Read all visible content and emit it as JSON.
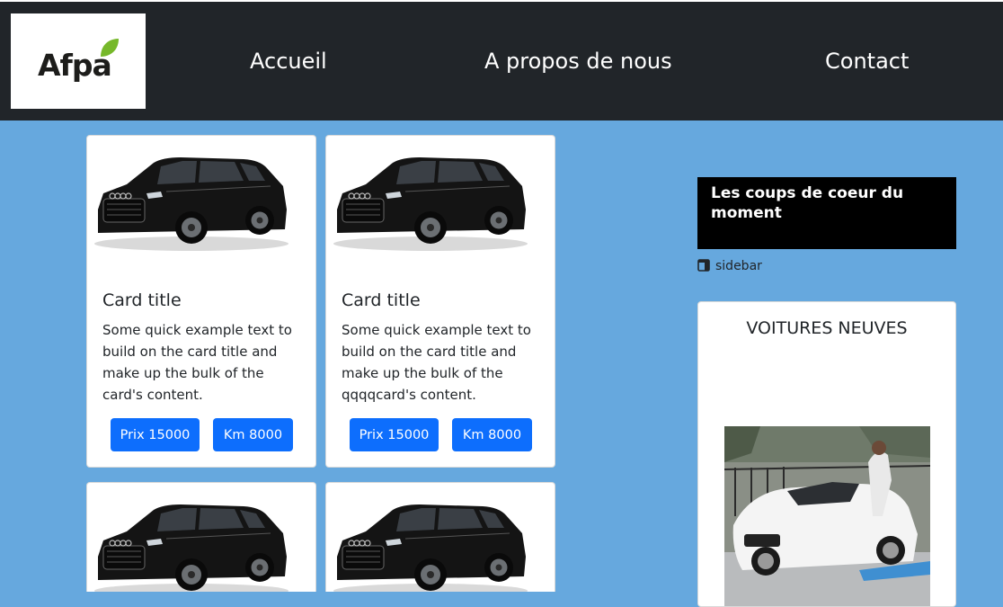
{
  "header": {
    "logo_text": "Afpa",
    "nav": [
      {
        "label": "Accueil"
      },
      {
        "label": "A propos de nous"
      },
      {
        "label": "Contact"
      }
    ]
  },
  "cards": [
    {
      "title": "Card title",
      "text": "Some quick example text to build on the card title and make up the bulk of the card's content.",
      "price_label": "Prix 15000",
      "km_label": "Km 8000"
    },
    {
      "title": "Card title",
      "text": "Some quick example text to build on the card title and make up the bulk of the qqqqcard's content.",
      "price_label": "Prix 15000",
      "km_label": "Km 8000"
    },
    {
      "title": "",
      "text": "",
      "price_label": "",
      "km_label": ""
    },
    {
      "title": "",
      "text": "",
      "price_label": "",
      "km_label": ""
    }
  ],
  "sidebar": {
    "heading": "Les coups de coeur du moment",
    "link_label": "sidebar",
    "link_icon": "sidebar-layout-icon",
    "card_title": "VOITURES NEUVES"
  },
  "colors": {
    "page_bg": "#66a8de",
    "navbar_bg": "#212529",
    "button_bg": "#0d6efd",
    "logo_leaf": "#76b82a"
  }
}
